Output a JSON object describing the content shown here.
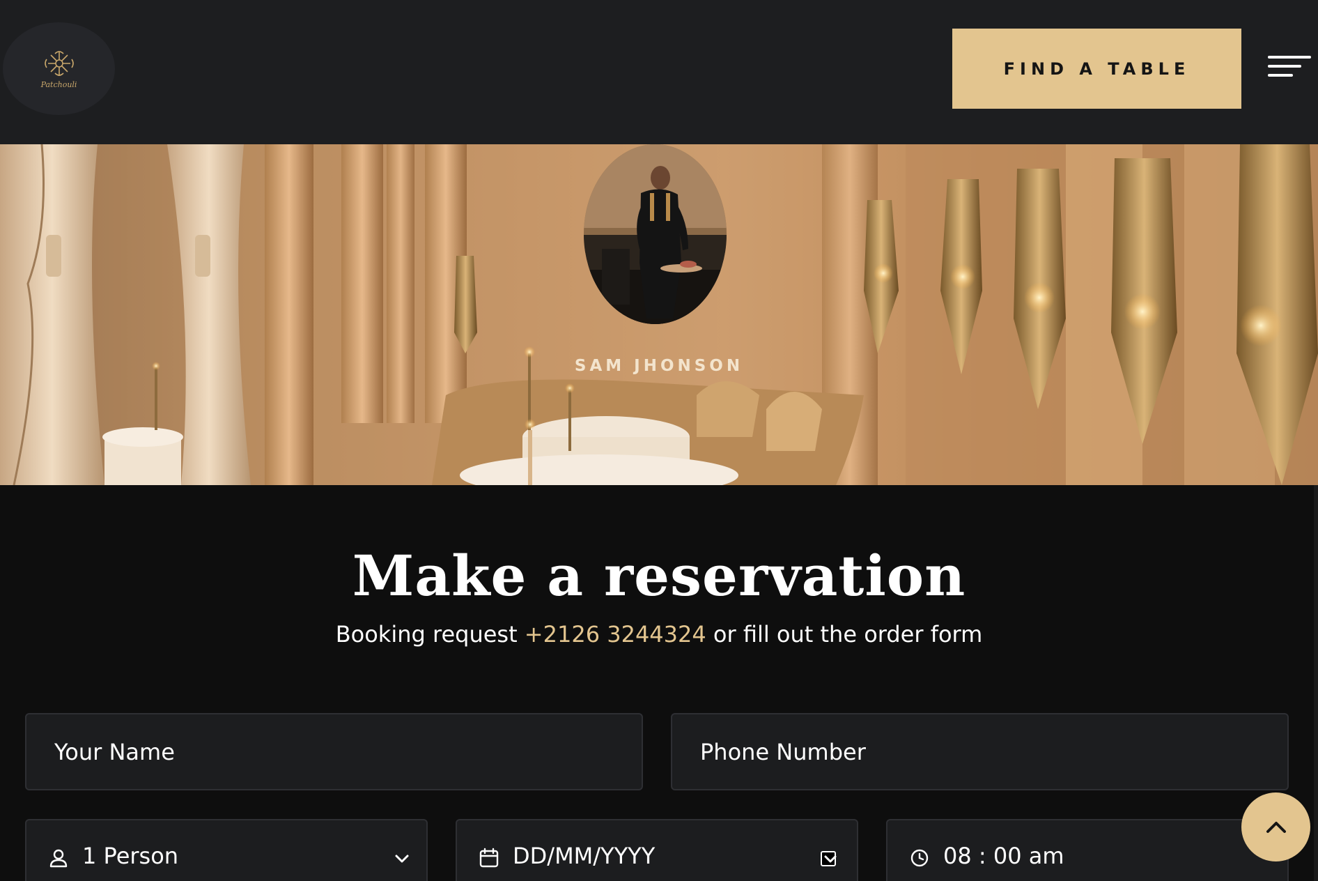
{
  "header": {
    "logo_text": "Patchouli",
    "cta_label": "FIND A TABLE",
    "menu_icon": "hamburger-menu-icon"
  },
  "hero": {
    "chef_name": "SAM JHONSON"
  },
  "reservation": {
    "title": "Make a reservation",
    "subtitle_before": "Booking request ",
    "phone": "+2126 3244324",
    "subtitle_after": " or fill out the order form",
    "name_placeholder": "Your Name",
    "phone_placeholder": "Phone Number",
    "guests_value": "1 Person",
    "date_value": "DD/MM/YYYY",
    "time_value": "08 : 00 am"
  },
  "colors": {
    "accent": "#e3c58f",
    "header_bg": "#1d1e20",
    "page_bg": "#0e0e0e",
    "field_bg": "#1c1d1f"
  }
}
